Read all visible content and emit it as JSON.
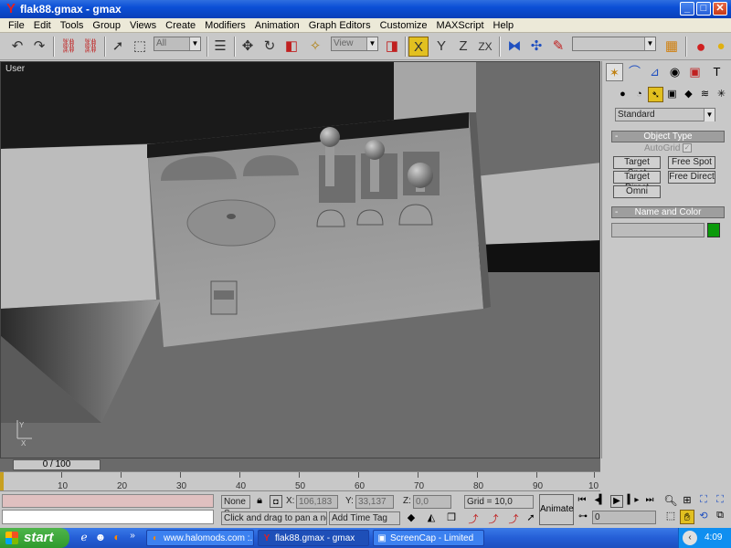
{
  "window": {
    "title": "flak88.gmax - gmax",
    "min": "_",
    "max": "□",
    "close": "✕"
  },
  "menu": [
    "File",
    "Edit",
    "Tools",
    "Group",
    "Views",
    "Create",
    "Modifiers",
    "Animation",
    "Graph Editors",
    "Customize",
    "MAXScript",
    "Help"
  ],
  "toolbar": {
    "selection_filter": "All",
    "ref_coord": "View",
    "axis_x": "X",
    "axis_y": "Y",
    "axis_z": "Z",
    "axis_zx": "ZX",
    "named_sel": ""
  },
  "viewport": {
    "label": "User"
  },
  "command_panel": {
    "category": "Standard",
    "object_type_title": "Object Type",
    "autogrid": "AutoGrid",
    "buttons": [
      "Target Spot",
      "Free Spot",
      "Target Direct",
      "Free Direct",
      "Omni"
    ],
    "name_color_title": "Name and Color",
    "object_name": "",
    "color": "#0a9a0a"
  },
  "timeline": {
    "frame": "0 / 100",
    "ticks": [
      "10",
      "20",
      "30",
      "40",
      "50",
      "60",
      "70",
      "80",
      "90",
      "10"
    ]
  },
  "status": {
    "selection": "None S",
    "x_label": "X:",
    "x_value": "106,183",
    "y_label": "Y:",
    "y_value": "33,137",
    "z_label": "Z:",
    "z_value": "0,0",
    "grid": "Grid = 10,0",
    "prompt": "Click and drag to pan a non-ca",
    "time_tag": "Add Time Tag",
    "animate": "Animate",
    "frame_field": "0"
  },
  "taskbar": {
    "start": "start",
    "tasks": [
      "www.halomods.com :...",
      "flak88.gmax - gmax",
      "ScreenCap - Limited"
    ],
    "clock": "4:09"
  }
}
